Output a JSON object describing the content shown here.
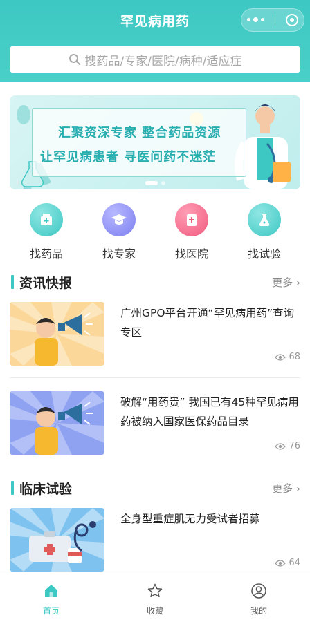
{
  "header": {
    "title": "罕见病用药",
    "search_placeholder": "搜药品/专家/医院/病种/适应症"
  },
  "banner": {
    "line1": "汇聚资深专家 整合药品资源",
    "line2": "让罕见病患者 寻医问药不迷茫"
  },
  "quick_nav": [
    {
      "label": "找药品",
      "icon": "medicine-box-icon",
      "color": "#3ec8c3"
    },
    {
      "label": "找专家",
      "icon": "graduation-cap-icon",
      "color": "#7d7ff0"
    },
    {
      "label": "找医院",
      "icon": "hospital-icon",
      "color": "#f05a7e"
    },
    {
      "label": "找试验",
      "icon": "flask-icon",
      "color": "#3ec8c3"
    }
  ],
  "news_section": {
    "title": "资讯快报",
    "more": "更多",
    "items": [
      {
        "title": "广州GPO平台开通“罕见病用药”查询专区",
        "views": "68"
      },
      {
        "title": "破解“用药贵” 我国已有45种罕见病用药被纳入国家医保药品目录",
        "views": "76"
      }
    ]
  },
  "trial_section": {
    "title": "临床试验",
    "more": "更多",
    "items": [
      {
        "title": "全身型重症肌无力受试者招募",
        "views": "64"
      }
    ]
  },
  "tabbar": [
    {
      "label": "首页",
      "icon": "home-icon",
      "active": true
    },
    {
      "label": "收藏",
      "icon": "star-icon",
      "active": false
    },
    {
      "label": "我的",
      "icon": "user-icon",
      "active": false
    }
  ],
  "colors": {
    "accent": "#3ec8c3"
  }
}
